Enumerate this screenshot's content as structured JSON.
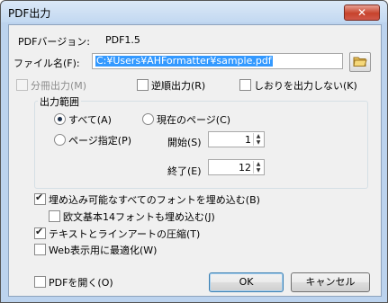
{
  "window": {
    "title": "PDF出力",
    "close_label": "✕"
  },
  "version": {
    "label": "PDFバージョン:",
    "value": "PDF1.5"
  },
  "filename": {
    "label": "ファイル名(F):",
    "value": "C:¥Users¥AHFormatter¥sample.pdf"
  },
  "options_row": {
    "split": "分冊出力(M)",
    "reverse": "逆順出力(R)",
    "no_bookmarks": "しおりを出力しない(K)"
  },
  "range": {
    "group_title": "出力範囲",
    "all": "すべて(A)",
    "current": "現在のページ(C)",
    "pages": "ページ指定(P)",
    "start_label": "開始(S)",
    "start_value": "1",
    "end_label": "終了(E)",
    "end_value": "12"
  },
  "embed": {
    "embed_all": "埋め込み可能なすべてのフォントを埋め込む(B)",
    "embed_base14": "欧文基本14フォントも埋め込む(J)",
    "compress": "テキストとラインアートの圧縮(T)",
    "web_optimize": "Web表示用に最適化(W)"
  },
  "footer": {
    "open_pdf": "PDFを開く(O)",
    "ok": "OK",
    "cancel": "キャンセル"
  },
  "states": {
    "split_checked": false,
    "reverse_checked": false,
    "no_bookmarks_checked": false,
    "range_selected": "all",
    "embed_all_checked": true,
    "embed_base14_checked": false,
    "compress_checked": true,
    "web_optimize_checked": false,
    "open_pdf_checked": false
  },
  "icons": {
    "close": "close-icon",
    "folder": "folder-icon",
    "spin_up": "spin-up-icon",
    "spin_down": "spin-down-icon"
  }
}
